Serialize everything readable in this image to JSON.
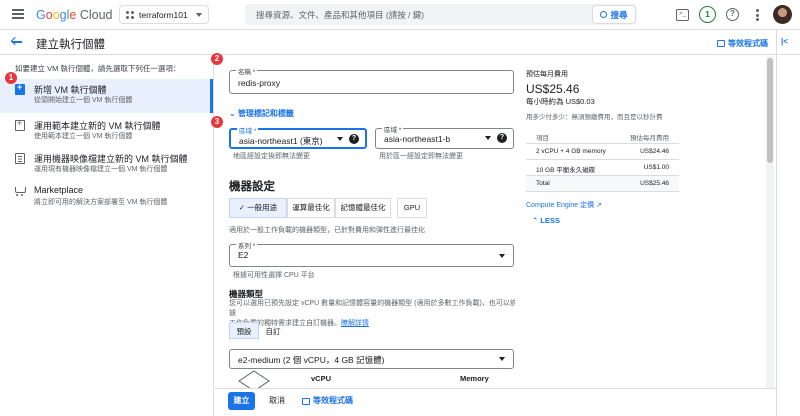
{
  "topbar": {
    "logo": {
      "google": "Google",
      "cloud": "Cloud"
    },
    "project": "terraform101",
    "search_placeholder": "搜尋資源、文件、產品和其他項目 (請按 / 鍵)",
    "search_button": "搜尋",
    "notification_count": "1",
    "help_glyph": "?"
  },
  "header": {
    "title": "建立執行個體",
    "equivalent_code": "等效程式碼",
    "collapse": "|<"
  },
  "left": {
    "intro": "如要建立 VM 執行個體，請先選取下列任一選項：",
    "options": [
      {
        "title": "新增 VM 執行個體",
        "desc": "從頭開始建立一個 VM 執行個體",
        "icon": "add-box-icon"
      },
      {
        "title": "運用範本建立新的 VM 執行個體",
        "desc": "使用範本建立一個 VM 執行個體",
        "icon": "template-icon"
      },
      {
        "title": "運用機器映像檔建立新的 VM 執行個體",
        "desc": "運用現有機器映像檔建立一個 VM 執行個體",
        "icon": "machine-image-icon"
      },
      {
        "title": "Marketplace",
        "desc": "將立即可用的解決方案部署至 VM 執行個體",
        "icon": "marketplace-icon"
      }
    ]
  },
  "callouts": [
    "1",
    "2",
    "3"
  ],
  "form": {
    "name_label": "名稱 *",
    "name_value": "redis-proxy",
    "manage_tags": "管理標記和標籤",
    "region_label": "區域 *",
    "region_value": "asia-northeast1 (東京)",
    "region_helper": "地區經設定後即無法變更",
    "zone_label": "區域 *",
    "zone_value": "asia-northeast1-b",
    "zone_helper": "用於區一經設定即無法變更",
    "machine_config_title": "機器設定",
    "tabs": [
      "一般用途",
      "運算最佳化",
      "記憶體最佳化",
      "GPU"
    ],
    "tab_check": "✓",
    "tab_desc": "適用於一般工作負載的機器類型，已針對費用和彈性進行最佳化",
    "series_label": "系列 *",
    "series_value": "E2",
    "series_helper": "根據可用性選擇 CPU 平台",
    "machine_type_title": "機器類型",
    "machine_type_desc_1": "您可以選用已預先設定 vCPU 數量和記憶體容量的機器類型 (適用於多數工作負載)，也可以依據",
    "machine_type_desc_2": "工作負載的獨特需求建立自訂機器。",
    "learn_more": "瞭解詳情",
    "preset_tabs": [
      "預設",
      "自訂"
    ],
    "machine_type_value": "e2-medium (2 個 vCPU，4 GB 記憶體)",
    "col_vcpu": "vCPU",
    "col_memory": "Memory"
  },
  "pricing": {
    "header": "預估每月費用",
    "total": "US$25.46",
    "hourly": "每小時約為 US$0.03",
    "note": "用多少付多少：無須預繳費用，而且是以秒計費",
    "table_header": {
      "item": "項目",
      "cost": "預估每月費用"
    },
    "rows": [
      {
        "item": "2 vCPU + 4 GB memory",
        "cost": "US$24.46"
      },
      {
        "item": "10 GB 平衡永久磁碟",
        "cost": "US$1.00"
      },
      {
        "item": "Total",
        "cost": "US$25.46"
      }
    ],
    "pricing_link": "Compute Engine 定價",
    "less": "LESS"
  },
  "actions": {
    "create": "建立",
    "cancel": "取消",
    "equivalent_code": "等效程式碼"
  },
  "colors": {
    "primary": "#1a73e8",
    "callout": "#e8363c",
    "badge": "#188038",
    "selected_bg": "#e8f0fe"
  }
}
